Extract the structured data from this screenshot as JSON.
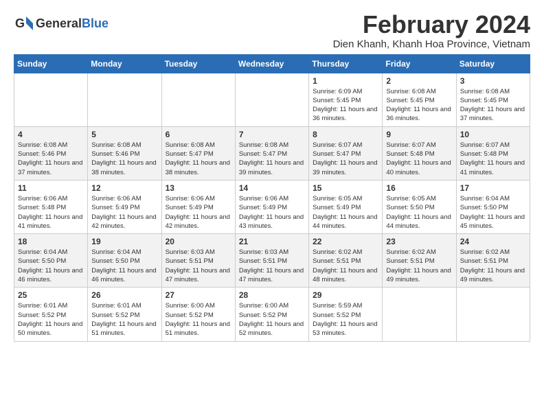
{
  "logo": {
    "text_general": "General",
    "text_blue": "Blue"
  },
  "header": {
    "month_year": "February 2024",
    "location": "Dien Khanh, Khanh Hoa Province, Vietnam"
  },
  "days_of_week": [
    "Sunday",
    "Monday",
    "Tuesday",
    "Wednesday",
    "Thursday",
    "Friday",
    "Saturday"
  ],
  "weeks": [
    [
      {
        "day": "",
        "info": ""
      },
      {
        "day": "",
        "info": ""
      },
      {
        "day": "",
        "info": ""
      },
      {
        "day": "",
        "info": ""
      },
      {
        "day": "1",
        "info": "Sunrise: 6:09 AM\nSunset: 5:45 PM\nDaylight: 11 hours and 36 minutes."
      },
      {
        "day": "2",
        "info": "Sunrise: 6:08 AM\nSunset: 5:45 PM\nDaylight: 11 hours and 36 minutes."
      },
      {
        "day": "3",
        "info": "Sunrise: 6:08 AM\nSunset: 5:45 PM\nDaylight: 11 hours and 37 minutes."
      }
    ],
    [
      {
        "day": "4",
        "info": "Sunrise: 6:08 AM\nSunset: 5:46 PM\nDaylight: 11 hours and 37 minutes."
      },
      {
        "day": "5",
        "info": "Sunrise: 6:08 AM\nSunset: 5:46 PM\nDaylight: 11 hours and 38 minutes."
      },
      {
        "day": "6",
        "info": "Sunrise: 6:08 AM\nSunset: 5:47 PM\nDaylight: 11 hours and 38 minutes."
      },
      {
        "day": "7",
        "info": "Sunrise: 6:08 AM\nSunset: 5:47 PM\nDaylight: 11 hours and 39 minutes."
      },
      {
        "day": "8",
        "info": "Sunrise: 6:07 AM\nSunset: 5:47 PM\nDaylight: 11 hours and 39 minutes."
      },
      {
        "day": "9",
        "info": "Sunrise: 6:07 AM\nSunset: 5:48 PM\nDaylight: 11 hours and 40 minutes."
      },
      {
        "day": "10",
        "info": "Sunrise: 6:07 AM\nSunset: 5:48 PM\nDaylight: 11 hours and 41 minutes."
      }
    ],
    [
      {
        "day": "11",
        "info": "Sunrise: 6:06 AM\nSunset: 5:48 PM\nDaylight: 11 hours and 41 minutes."
      },
      {
        "day": "12",
        "info": "Sunrise: 6:06 AM\nSunset: 5:49 PM\nDaylight: 11 hours and 42 minutes."
      },
      {
        "day": "13",
        "info": "Sunrise: 6:06 AM\nSunset: 5:49 PM\nDaylight: 11 hours and 42 minutes."
      },
      {
        "day": "14",
        "info": "Sunrise: 6:06 AM\nSunset: 5:49 PM\nDaylight: 11 hours and 43 minutes."
      },
      {
        "day": "15",
        "info": "Sunrise: 6:05 AM\nSunset: 5:49 PM\nDaylight: 11 hours and 44 minutes."
      },
      {
        "day": "16",
        "info": "Sunrise: 6:05 AM\nSunset: 5:50 PM\nDaylight: 11 hours and 44 minutes."
      },
      {
        "day": "17",
        "info": "Sunrise: 6:04 AM\nSunset: 5:50 PM\nDaylight: 11 hours and 45 minutes."
      }
    ],
    [
      {
        "day": "18",
        "info": "Sunrise: 6:04 AM\nSunset: 5:50 PM\nDaylight: 11 hours and 46 minutes."
      },
      {
        "day": "19",
        "info": "Sunrise: 6:04 AM\nSunset: 5:50 PM\nDaylight: 11 hours and 46 minutes."
      },
      {
        "day": "20",
        "info": "Sunrise: 6:03 AM\nSunset: 5:51 PM\nDaylight: 11 hours and 47 minutes."
      },
      {
        "day": "21",
        "info": "Sunrise: 6:03 AM\nSunset: 5:51 PM\nDaylight: 11 hours and 47 minutes."
      },
      {
        "day": "22",
        "info": "Sunrise: 6:02 AM\nSunset: 5:51 PM\nDaylight: 11 hours and 48 minutes."
      },
      {
        "day": "23",
        "info": "Sunrise: 6:02 AM\nSunset: 5:51 PM\nDaylight: 11 hours and 49 minutes."
      },
      {
        "day": "24",
        "info": "Sunrise: 6:02 AM\nSunset: 5:51 PM\nDaylight: 11 hours and 49 minutes."
      }
    ],
    [
      {
        "day": "25",
        "info": "Sunrise: 6:01 AM\nSunset: 5:52 PM\nDaylight: 11 hours and 50 minutes."
      },
      {
        "day": "26",
        "info": "Sunrise: 6:01 AM\nSunset: 5:52 PM\nDaylight: 11 hours and 51 minutes."
      },
      {
        "day": "27",
        "info": "Sunrise: 6:00 AM\nSunset: 5:52 PM\nDaylight: 11 hours and 51 minutes."
      },
      {
        "day": "28",
        "info": "Sunrise: 6:00 AM\nSunset: 5:52 PM\nDaylight: 11 hours and 52 minutes."
      },
      {
        "day": "29",
        "info": "Sunrise: 5:59 AM\nSunset: 5:52 PM\nDaylight: 11 hours and 53 minutes."
      },
      {
        "day": "",
        "info": ""
      },
      {
        "day": "",
        "info": ""
      }
    ]
  ]
}
